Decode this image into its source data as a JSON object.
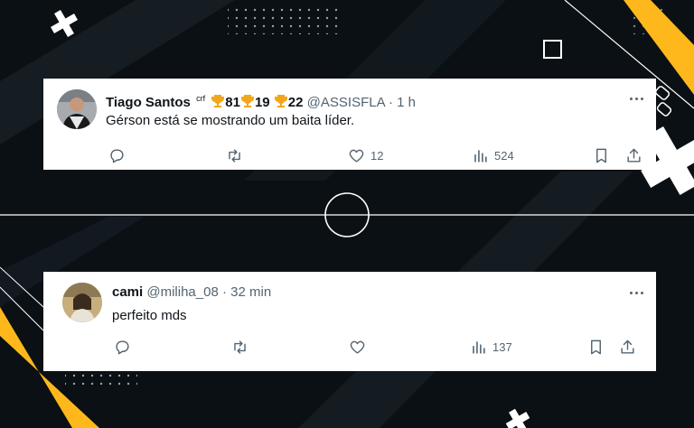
{
  "tweets": [
    {
      "author_name": "Tiago Santos",
      "author_sup": "crf",
      "badges": [
        {
          "icon": "trophy-icon",
          "count": "81"
        },
        {
          "icon": "trophy-icon",
          "count": "19"
        },
        {
          "icon": "trophy-icon",
          "count": "22"
        }
      ],
      "handle": "@ASSISFLA",
      "separator": "·",
      "time": "1 h",
      "text": "Gérson está se mostrando um baita líder.",
      "reply_count": "",
      "retweet_count": "",
      "like_count": "12",
      "view_count": "524"
    },
    {
      "author_name": "cami",
      "handle": "@miliha_08",
      "separator": "·",
      "time": "32 min",
      "text": "perfeito mds",
      "reply_count": "",
      "retweet_count": "",
      "like_count": "",
      "view_count": "137"
    }
  ],
  "colors": {
    "background": "#0b1014",
    "accent_yellow": "#ffb81c",
    "text_primary": "#0f1419",
    "text_secondary": "#536471"
  }
}
